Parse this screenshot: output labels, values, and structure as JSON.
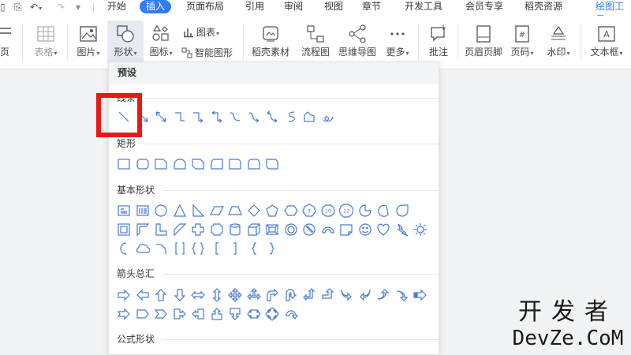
{
  "menubar": {
    "items": [
      {
        "label": "开始"
      },
      {
        "label": "插入",
        "active": true
      },
      {
        "label": "页面布局"
      },
      {
        "label": "引用"
      },
      {
        "label": "审阅"
      },
      {
        "label": "视图"
      },
      {
        "label": "章节"
      },
      {
        "label": "开发工具"
      },
      {
        "label": "会员专享"
      },
      {
        "label": "稻壳资源"
      },
      {
        "label": "绘图工具",
        "tool": true
      }
    ]
  },
  "ribbon": {
    "page_label": "页",
    "table_label": "表格",
    "picture_label": "图片",
    "shape_label": "形状",
    "icon_label": "图标",
    "chart_label": "图表",
    "smart_label": "智能图形",
    "material_label": "稻壳素材",
    "flowchart_label": "流程图",
    "mindmap_label": "思维导图",
    "more_label": "更多",
    "comment_label": "批注",
    "header_footer_label": "页眉页脚",
    "page_number_label": "页码",
    "watermark_label": "水印",
    "textbox_label": "文本框"
  },
  "panel": {
    "title": "预设",
    "sections": [
      {
        "title": "线条"
      },
      {
        "title": "矩形"
      },
      {
        "title": "基本形状"
      },
      {
        "title": "箭头总汇"
      },
      {
        "title": "公式形状"
      }
    ]
  },
  "basic_shape_text": {
    "oct": "7",
    "dec": "10",
    "dodec": "12"
  },
  "watermark": {
    "cn": "开发者",
    "en": "DevZe.CoM"
  },
  "colors": {
    "accent": "#2f7cf6",
    "shape_stroke": "#4a7bd0",
    "highlight": "#e61919"
  }
}
